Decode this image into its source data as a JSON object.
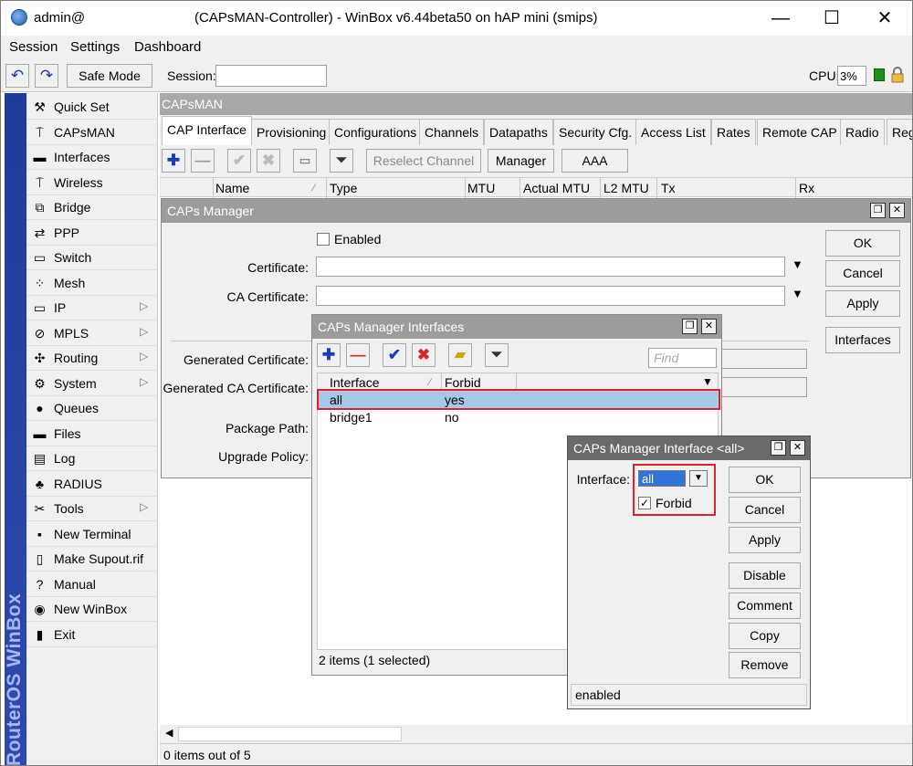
{
  "window": {
    "user": "admin@",
    "title": "(CAPsMAN-Controller) - WinBox v6.44beta50 on hAP mini (smips)",
    "minimize": "—",
    "maximize": "☐",
    "close": "✕"
  },
  "menu": {
    "session": "Session",
    "settings": "Settings",
    "dashboard": "Dashboard"
  },
  "toolbar": {
    "undo": "↶",
    "redo": "↷",
    "safe_mode": "Safe Mode",
    "session_label": "Session:",
    "session_value": "",
    "cpu_label": "CPU:",
    "cpu_value": "3%"
  },
  "sidebar": {
    "brand": "RouterOS WinBox",
    "items": [
      {
        "label": "Quick Set",
        "icon": "quick-set-icon",
        "glyph": "⚒",
        "arrow": ""
      },
      {
        "label": "CAPsMAN",
        "icon": "antenna-icon",
        "glyph": "⍑",
        "arrow": ""
      },
      {
        "label": "Interfaces",
        "icon": "interfaces-icon",
        "glyph": "▬",
        "arrow": ""
      },
      {
        "label": "Wireless",
        "icon": "wireless-icon",
        "glyph": "⍑",
        "arrow": ""
      },
      {
        "label": "Bridge",
        "icon": "bridge-icon",
        "glyph": "⧉",
        "arrow": ""
      },
      {
        "label": "PPP",
        "icon": "ppp-icon",
        "glyph": "⇄",
        "arrow": ""
      },
      {
        "label": "Switch",
        "icon": "switch-icon",
        "glyph": "▭",
        "arrow": ""
      },
      {
        "label": "Mesh",
        "icon": "mesh-icon",
        "glyph": "⁘",
        "arrow": ""
      },
      {
        "label": "IP",
        "icon": "ip-icon",
        "glyph": "▭",
        "arrow": "▷"
      },
      {
        "label": "MPLS",
        "icon": "mpls-icon",
        "glyph": "⊘",
        "arrow": "▷"
      },
      {
        "label": "Routing",
        "icon": "routing-icon",
        "glyph": "✣",
        "arrow": "▷"
      },
      {
        "label": "System",
        "icon": "system-gear-icon",
        "glyph": "⚙",
        "arrow": "▷"
      },
      {
        "label": "Queues",
        "icon": "queues-icon",
        "glyph": "●",
        "arrow": ""
      },
      {
        "label": "Files",
        "icon": "files-folder-icon",
        "glyph": "▬",
        "arrow": ""
      },
      {
        "label": "Log",
        "icon": "log-icon",
        "glyph": "▤",
        "arrow": ""
      },
      {
        "label": "RADIUS",
        "icon": "radius-users-icon",
        "glyph": "♣",
        "arrow": ""
      },
      {
        "label": "Tools",
        "icon": "tools-icon",
        "glyph": "✂",
        "arrow": "▷"
      },
      {
        "label": "New Terminal",
        "icon": "terminal-icon",
        "glyph": "▪",
        "arrow": ""
      },
      {
        "label": "Make Supout.rif",
        "icon": "supout-icon",
        "glyph": "▯",
        "arrow": ""
      },
      {
        "label": "Manual",
        "icon": "manual-help-icon",
        "glyph": "?",
        "arrow": ""
      },
      {
        "label": "New WinBox",
        "icon": "winbox-icon",
        "glyph": "◉",
        "arrow": ""
      },
      {
        "label": "Exit",
        "icon": "exit-icon",
        "glyph": "▮",
        "arrow": ""
      }
    ]
  },
  "capsman": {
    "header": "CAPsMAN",
    "tabs": [
      "CAP Interface",
      "Provisioning",
      "Configurations",
      "Channels",
      "Datapaths",
      "Security Cfg.",
      "Access List",
      "Rates",
      "Remote CAP",
      "Radio",
      "Reg"
    ],
    "buttons": {
      "reselect": "Reselect Channel",
      "manager": "Manager",
      "aaa": "AAA"
    },
    "columns": [
      "Name",
      "Type",
      "MTU",
      "Actual MTU",
      "L2 MTU",
      "Tx",
      "Rx"
    ],
    "status": "0 items out of 5"
  },
  "manager": {
    "title": "CAPs Manager",
    "enabled_label": "Enabled",
    "certificate_label": "Certificate:",
    "ca_certificate_label": "CA Certificate:",
    "generated_certificate_label": "Generated Certificate:",
    "generated_ca_certificate_label": "Generated CA Certificate:",
    "package_path_label": "Package Path:",
    "upgrade_policy_label": "Upgrade Policy:",
    "ok": "OK",
    "cancel": "Cancel",
    "apply": "Apply",
    "interfaces": "Interfaces"
  },
  "mgr_interfaces": {
    "title": "CAPs Manager Interfaces",
    "find_placeholder": "Find",
    "columns": [
      "Interface",
      "Forbid"
    ],
    "rows": [
      {
        "interface": "all",
        "forbid": "yes"
      },
      {
        "interface": "bridge1",
        "forbid": "no"
      }
    ],
    "status": "2 items (1 selected)"
  },
  "mgr_interface": {
    "title": "CAPs Manager Interface <all>",
    "interface_label": "Interface:",
    "interface_value": "all",
    "forbid_label": "Forbid",
    "ok": "OK",
    "cancel": "Cancel",
    "apply": "Apply",
    "disable": "Disable",
    "comment": "Comment",
    "copy": "Copy",
    "remove": "Remove",
    "status": "enabled"
  },
  "colors": {
    "accent_red": "#d9242f",
    "selection": "#a7c7ea",
    "brand_blue": "#1f3b9a"
  }
}
